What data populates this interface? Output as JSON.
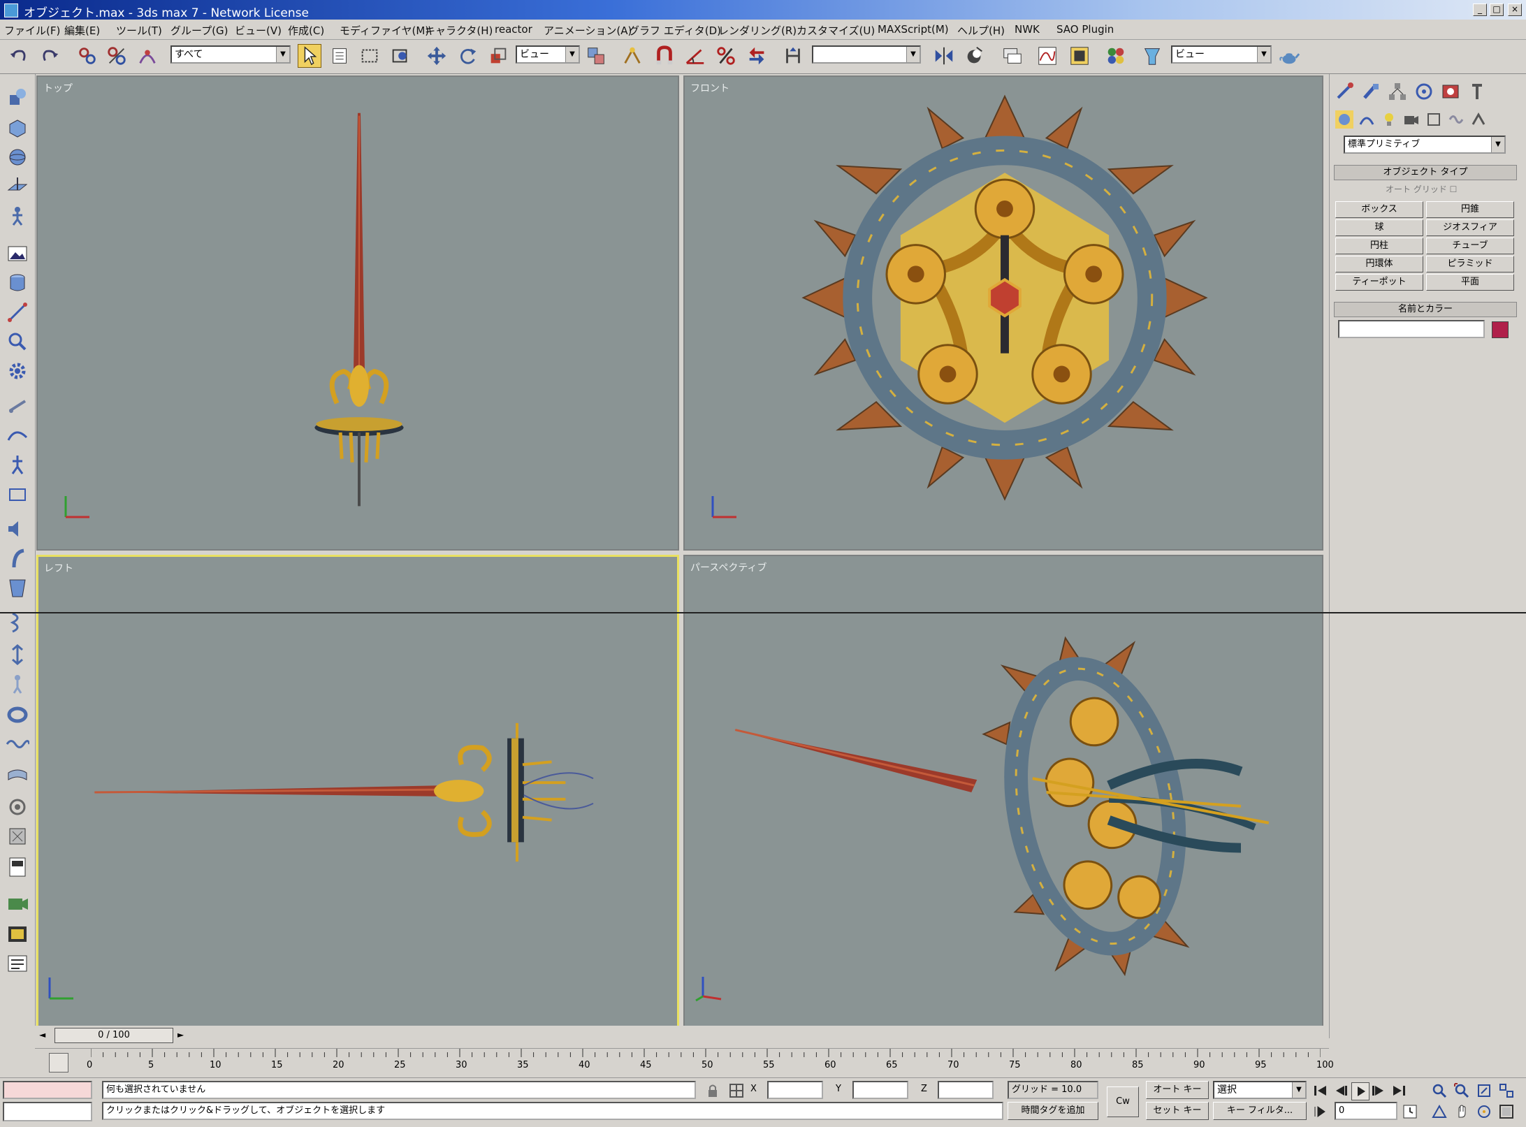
{
  "window": {
    "title": "オブジェクト.max - 3ds max 7 - Network License",
    "minimize": "_",
    "maximize": "□",
    "close": "×"
  },
  "menu": [
    "ファイル(F)",
    "編集(E)",
    "ツール(T)",
    "グループ(G)",
    "ビュー(V)",
    "作成(C)",
    "モディファイヤ(M)",
    "キャラクタ(H)",
    "reactor",
    "アニメーション(A)",
    "グラフ エディタ(D)",
    "レンダリング(R)",
    "カスタマイズ(U)",
    "MAXScript(M)",
    "ヘルプ(H)",
    "NWK",
    "SAO Plugin"
  ],
  "toolbar": {
    "selection_filter": "すべて",
    "reference_coord": "ビュー",
    "named_selection": "",
    "render_type": "ビュー"
  },
  "viewports": {
    "top": "トップ",
    "front": "フロント",
    "left": "レフト",
    "perspective": "パースペクティブ"
  },
  "command_panel": {
    "category_dropdown": "標準プリミティブ",
    "rollout_object_type": "オブジェクト タイプ",
    "autogrid_label": "オート グリッド",
    "object_buttons": [
      "ボックス",
      "円錐",
      "球",
      "ジオスフィア",
      "円柱",
      "チューブ",
      "円環体",
      "ピラミッド",
      "ティーポット",
      "平面"
    ],
    "rollout_name_color": "名前とカラー",
    "name_value": "",
    "color": "#b0204a"
  },
  "timeslider": {
    "frame_label": "0 / 100"
  },
  "trackbar": {
    "ticks": [
      "0",
      "5",
      "10",
      "15",
      "20",
      "25",
      "30",
      "35",
      "40",
      "45",
      "50",
      "55",
      "60",
      "65",
      "70",
      "75",
      "80",
      "85",
      "90",
      "95",
      "100"
    ]
  },
  "status": {
    "selection_msg": "何も選択されていません",
    "prompt_msg": "クリックまたはクリック&ドラッグして、オブジェクトを選択します",
    "x_label": "X",
    "y_label": "Y",
    "z_label": "Z",
    "x_value": "",
    "y_value": "",
    "z_value": "",
    "grid": "グリッド = 10.0",
    "add_time_tag": "時間タグを追加",
    "auto_key": "オート キー",
    "set_key": "セット キー",
    "key_mode_select": "選択",
    "key_filters": "キー フィルタ...",
    "frame_field": "0",
    "cw_button": "Cw"
  }
}
